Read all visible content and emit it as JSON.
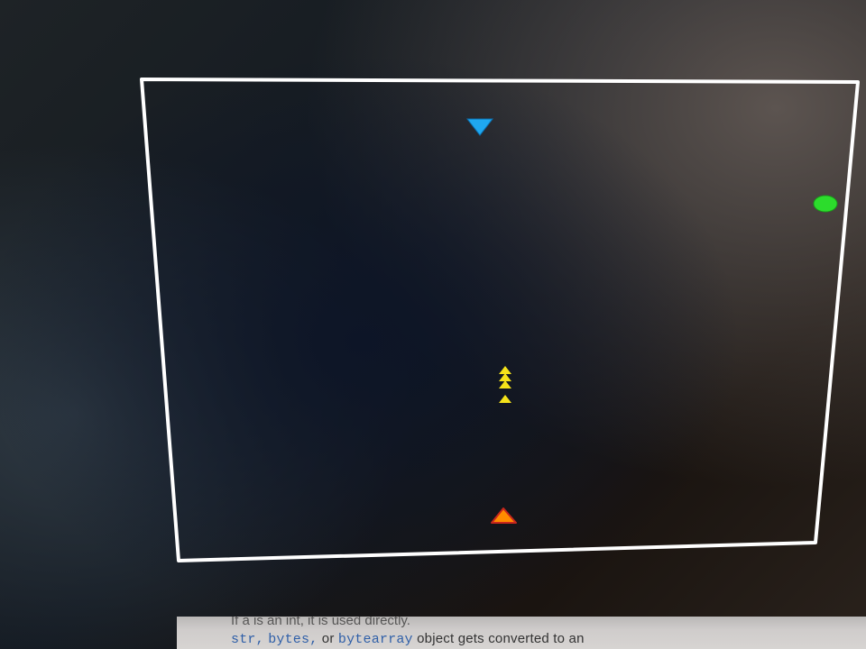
{
  "game": {
    "playfield_border_color": "#ffffff",
    "background_color": "#0d1422",
    "enemy": {
      "icon": "enemy-ship-icon",
      "shape": "down-triangle",
      "color": "#1fa8f0"
    },
    "player": {
      "icon": "player-ship-icon",
      "shape": "up-triangle",
      "color": "#ff8c00",
      "outline_color": "#c8261c"
    },
    "bonus": {
      "icon": "green-orb-icon",
      "shape": "ellipse",
      "color": "#2cdc2c"
    },
    "projectiles": {
      "icon": "bullet-arrow-icon",
      "shape": "chevron-up",
      "color": "#f4e21a",
      "count": 4
    }
  },
  "doc_text": {
    "line1": "If a is an int, it is used directly.",
    "line2_prefix": "",
    "line2_code1": "str,",
    "line2_code2": "bytes,",
    "line2_mid": "or",
    "line2_code3": "bytearray",
    "line2_suffix": "object gets converted to an"
  }
}
